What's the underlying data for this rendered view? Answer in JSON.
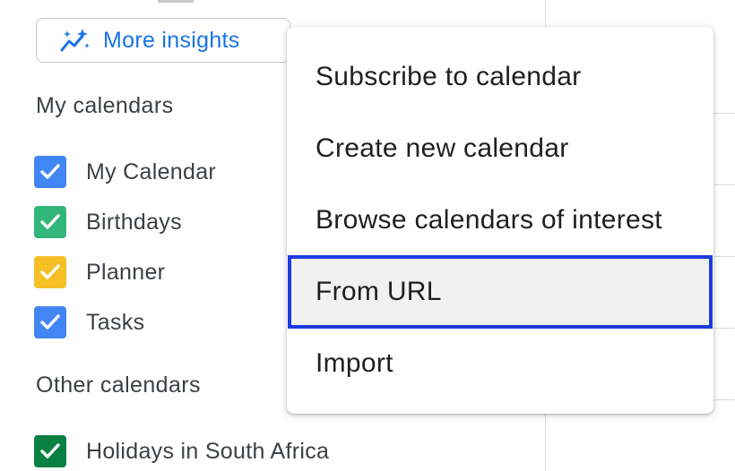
{
  "sidebar": {
    "insights_button": {
      "icon": "sparkle-chart-icon",
      "label": "More insights"
    },
    "my_calendars": {
      "title": "My calendars",
      "items": [
        {
          "label": "My Calendar",
          "color": "#4285f4",
          "checked": true
        },
        {
          "label": "Birthdays",
          "color": "#33b679",
          "checked": true
        },
        {
          "label": "Planner",
          "color": "#f6bf26",
          "checked": true
        },
        {
          "label": "Tasks",
          "color": "#4285f4",
          "checked": true
        }
      ]
    },
    "other_calendars": {
      "title": "Other calendars",
      "items": [
        {
          "label": "Holidays in South Africa",
          "color": "#0b8043",
          "checked": true
        }
      ]
    }
  },
  "menu": {
    "items": [
      {
        "label": "Subscribe to calendar"
      },
      {
        "label": "Create new calendar"
      },
      {
        "label": "Browse calendars of interest"
      },
      {
        "label": "From URL",
        "highlighted": true
      },
      {
        "label": "Import"
      }
    ]
  },
  "colors": {
    "accent": "#1a73e8",
    "highlight_outline": "#1a3de0",
    "menu_hover_bg": "#f1f1f1"
  }
}
